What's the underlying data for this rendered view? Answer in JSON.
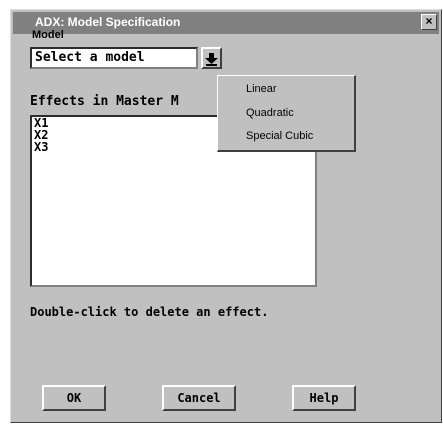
{
  "window": {
    "title": "ADX: Model Specification",
    "close_glyph": "×"
  },
  "model": {
    "label": "Model",
    "value": "Select a model",
    "dropdown_icon": "arrow-down-icon"
  },
  "effects": {
    "label": "Effects in Master M",
    "items": [
      "X1",
      "X2",
      "X3"
    ]
  },
  "hint": "Double-click to delete an effect.",
  "buttons": {
    "ok": "OK",
    "cancel": "Cancel",
    "help": "Help"
  },
  "dropdown_menu": {
    "items": [
      "Linear",
      "Quadratic",
      "Special Cubic"
    ]
  },
  "colors": {
    "titlebar": "#808080",
    "dialog": "#c0c0c0",
    "field": "#ffffff"
  }
}
